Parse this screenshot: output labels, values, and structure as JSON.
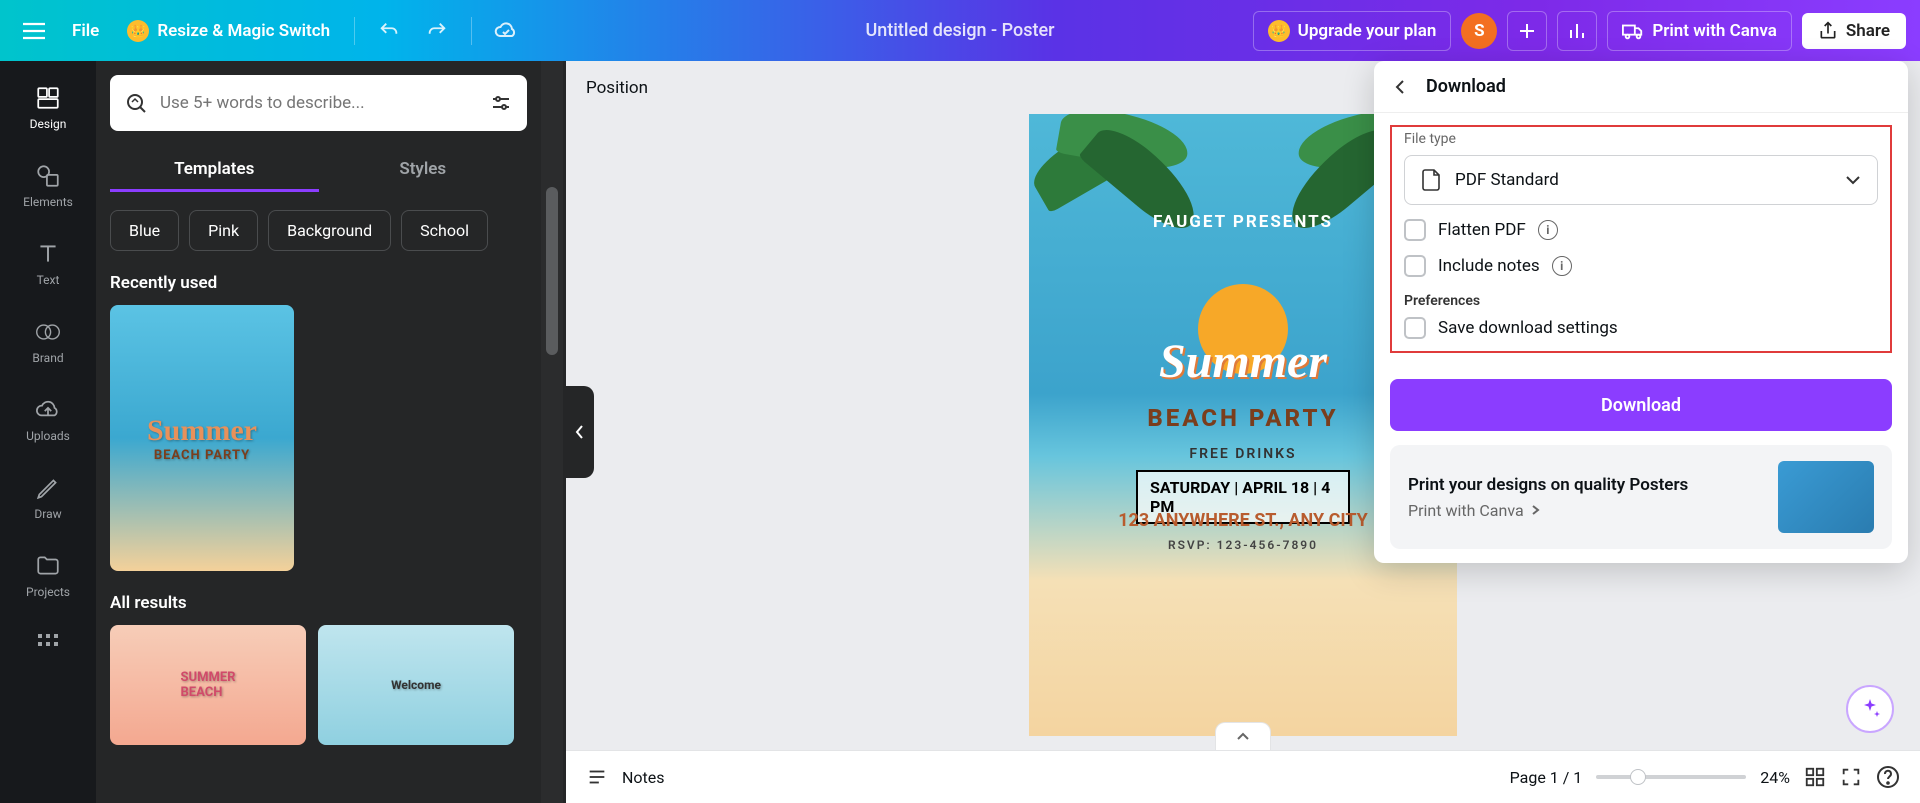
{
  "topbar": {
    "file": "File",
    "resize": "Resize & Magic Switch",
    "doc_title": "Untitled design - Poster",
    "upgrade": "Upgrade your plan",
    "avatar_letter": "S",
    "print": "Print with Canva",
    "share": "Share"
  },
  "sidebar": {
    "items": [
      {
        "label": "Design"
      },
      {
        "label": "Elements"
      },
      {
        "label": "Text"
      },
      {
        "label": "Brand"
      },
      {
        "label": "Uploads"
      },
      {
        "label": "Draw"
      },
      {
        "label": "Projects"
      }
    ]
  },
  "left_panel": {
    "search_placeholder": "Use 5+ words to describe...",
    "tabs": {
      "templates": "Templates",
      "styles": "Styles"
    },
    "chips": [
      "Blue",
      "Pink",
      "Background",
      "School"
    ],
    "recently_used": "Recently used",
    "all_results": "All results"
  },
  "canvas": {
    "position": "Position",
    "poster": {
      "presents": "FAUGET PRESENTS",
      "summer": "Summer",
      "beach_party": "BEACH PARTY",
      "free_drinks": "FREE DRINKS",
      "date_line": "SATURDAY | APRIL 18 | 4 PM",
      "address": "123 ANYWHERE ST., ANY CITY",
      "rsvp": "RSVP: 123-456-7890"
    },
    "bottom": {
      "notes": "Notes",
      "page": "Page 1 / 1",
      "zoom": "24%"
    }
  },
  "download": {
    "title": "Download",
    "file_type_label": "File type",
    "file_type_value": "PDF Standard",
    "flatten": "Flatten PDF",
    "include_notes": "Include notes",
    "preferences": "Preferences",
    "save_settings": "Save download settings",
    "button": "Download",
    "print_card_title": "Print your designs on quality Posters",
    "print_card_sub": "Print with Canva"
  }
}
